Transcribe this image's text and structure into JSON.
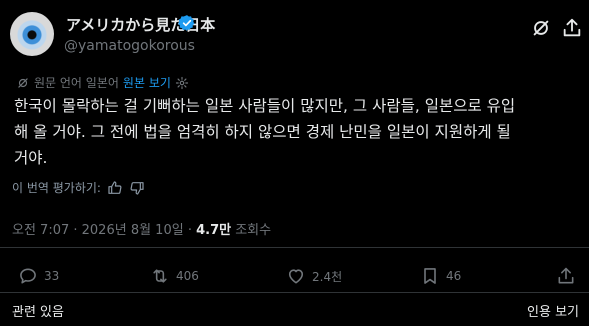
{
  "post": {
    "author_name": "アメリカから見た日本",
    "author_handle": "@yamatogokorous",
    "text": "한국이 몰락하는 걸 기뻐하는 일본 사람들이 많지만, 그 사람들, 일본으로 유입\n해 올 거야. 그 전에 법을 엄격히 하지 않으면 경제 난민을 일본이 지원하게 될\n거야.",
    "timestamp": "오전 7:07 · 2026년 8월 10일 · ",
    "views_count": "4.7만",
    "views_label": " 조회수"
  },
  "translation": {
    "label": "원문 언어 일본어",
    "show_original": "원본 보기"
  },
  "rating": {
    "label": "이 번역 평가하기:"
  },
  "actions": {
    "replies": "33",
    "reposts": "406",
    "likes": "2.4천",
    "bookmarks": "46"
  },
  "footer": {
    "related": "관련 있음",
    "quotes": "인용 보기"
  },
  "colors": {
    "background": "#000000",
    "text": "#e7e9ea",
    "muted": "#71767b",
    "accent": "#1d9bf0",
    "divider": "#2f3336"
  },
  "icons": [
    "verified-badge-icon",
    "translate-icon",
    "share-icon",
    "gear-icon",
    "thumbs-up-icon",
    "thumbs-down-icon",
    "reply-icon",
    "repost-icon",
    "like-icon",
    "bookmark-icon"
  ]
}
